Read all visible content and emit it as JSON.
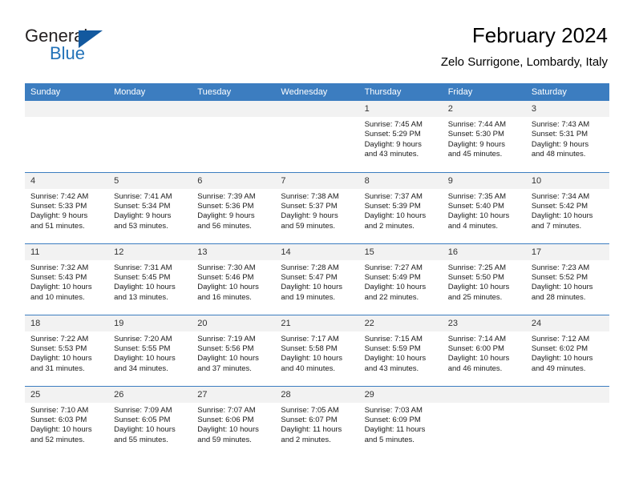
{
  "brand": {
    "name_part1": "General",
    "name_part2": "Blue",
    "accent_color": "#2272b8",
    "triangle_color": "#13599f"
  },
  "header": {
    "title": "February 2024",
    "subtitle": "Zelo Surrigone, Lombardy, Italy"
  },
  "theme": {
    "header_bg": "#3c7dc0",
    "daynum_bg": "#f2f2f2",
    "cell_bg": "#ffffff"
  },
  "weekday_headers": [
    "Sunday",
    "Monday",
    "Tuesday",
    "Wednesday",
    "Thursday",
    "Friday",
    "Saturday"
  ],
  "weeks": [
    [
      {
        "day": "",
        "sunrise": "",
        "sunset": "",
        "daylight1": "",
        "daylight2": ""
      },
      {
        "day": "",
        "sunrise": "",
        "sunset": "",
        "daylight1": "",
        "daylight2": ""
      },
      {
        "day": "",
        "sunrise": "",
        "sunset": "",
        "daylight1": "",
        "daylight2": ""
      },
      {
        "day": "",
        "sunrise": "",
        "sunset": "",
        "daylight1": "",
        "daylight2": ""
      },
      {
        "day": "1",
        "sunrise": "Sunrise: 7:45 AM",
        "sunset": "Sunset: 5:29 PM",
        "daylight1": "Daylight: 9 hours",
        "daylight2": "and 43 minutes."
      },
      {
        "day": "2",
        "sunrise": "Sunrise: 7:44 AM",
        "sunset": "Sunset: 5:30 PM",
        "daylight1": "Daylight: 9 hours",
        "daylight2": "and 45 minutes."
      },
      {
        "day": "3",
        "sunrise": "Sunrise: 7:43 AM",
        "sunset": "Sunset: 5:31 PM",
        "daylight1": "Daylight: 9 hours",
        "daylight2": "and 48 minutes."
      }
    ],
    [
      {
        "day": "4",
        "sunrise": "Sunrise: 7:42 AM",
        "sunset": "Sunset: 5:33 PM",
        "daylight1": "Daylight: 9 hours",
        "daylight2": "and 51 minutes."
      },
      {
        "day": "5",
        "sunrise": "Sunrise: 7:41 AM",
        "sunset": "Sunset: 5:34 PM",
        "daylight1": "Daylight: 9 hours",
        "daylight2": "and 53 minutes."
      },
      {
        "day": "6",
        "sunrise": "Sunrise: 7:39 AM",
        "sunset": "Sunset: 5:36 PM",
        "daylight1": "Daylight: 9 hours",
        "daylight2": "and 56 minutes."
      },
      {
        "day": "7",
        "sunrise": "Sunrise: 7:38 AM",
        "sunset": "Sunset: 5:37 PM",
        "daylight1": "Daylight: 9 hours",
        "daylight2": "and 59 minutes."
      },
      {
        "day": "8",
        "sunrise": "Sunrise: 7:37 AM",
        "sunset": "Sunset: 5:39 PM",
        "daylight1": "Daylight: 10 hours",
        "daylight2": "and 2 minutes."
      },
      {
        "day": "9",
        "sunrise": "Sunrise: 7:35 AM",
        "sunset": "Sunset: 5:40 PM",
        "daylight1": "Daylight: 10 hours",
        "daylight2": "and 4 minutes."
      },
      {
        "day": "10",
        "sunrise": "Sunrise: 7:34 AM",
        "sunset": "Sunset: 5:42 PM",
        "daylight1": "Daylight: 10 hours",
        "daylight2": "and 7 minutes."
      }
    ],
    [
      {
        "day": "11",
        "sunrise": "Sunrise: 7:32 AM",
        "sunset": "Sunset: 5:43 PM",
        "daylight1": "Daylight: 10 hours",
        "daylight2": "and 10 minutes."
      },
      {
        "day": "12",
        "sunrise": "Sunrise: 7:31 AM",
        "sunset": "Sunset: 5:45 PM",
        "daylight1": "Daylight: 10 hours",
        "daylight2": "and 13 minutes."
      },
      {
        "day": "13",
        "sunrise": "Sunrise: 7:30 AM",
        "sunset": "Sunset: 5:46 PM",
        "daylight1": "Daylight: 10 hours",
        "daylight2": "and 16 minutes."
      },
      {
        "day": "14",
        "sunrise": "Sunrise: 7:28 AM",
        "sunset": "Sunset: 5:47 PM",
        "daylight1": "Daylight: 10 hours",
        "daylight2": "and 19 minutes."
      },
      {
        "day": "15",
        "sunrise": "Sunrise: 7:27 AM",
        "sunset": "Sunset: 5:49 PM",
        "daylight1": "Daylight: 10 hours",
        "daylight2": "and 22 minutes."
      },
      {
        "day": "16",
        "sunrise": "Sunrise: 7:25 AM",
        "sunset": "Sunset: 5:50 PM",
        "daylight1": "Daylight: 10 hours",
        "daylight2": "and 25 minutes."
      },
      {
        "day": "17",
        "sunrise": "Sunrise: 7:23 AM",
        "sunset": "Sunset: 5:52 PM",
        "daylight1": "Daylight: 10 hours",
        "daylight2": "and 28 minutes."
      }
    ],
    [
      {
        "day": "18",
        "sunrise": "Sunrise: 7:22 AM",
        "sunset": "Sunset: 5:53 PM",
        "daylight1": "Daylight: 10 hours",
        "daylight2": "and 31 minutes."
      },
      {
        "day": "19",
        "sunrise": "Sunrise: 7:20 AM",
        "sunset": "Sunset: 5:55 PM",
        "daylight1": "Daylight: 10 hours",
        "daylight2": "and 34 minutes."
      },
      {
        "day": "20",
        "sunrise": "Sunrise: 7:19 AM",
        "sunset": "Sunset: 5:56 PM",
        "daylight1": "Daylight: 10 hours",
        "daylight2": "and 37 minutes."
      },
      {
        "day": "21",
        "sunrise": "Sunrise: 7:17 AM",
        "sunset": "Sunset: 5:58 PM",
        "daylight1": "Daylight: 10 hours",
        "daylight2": "and 40 minutes."
      },
      {
        "day": "22",
        "sunrise": "Sunrise: 7:15 AM",
        "sunset": "Sunset: 5:59 PM",
        "daylight1": "Daylight: 10 hours",
        "daylight2": "and 43 minutes."
      },
      {
        "day": "23",
        "sunrise": "Sunrise: 7:14 AM",
        "sunset": "Sunset: 6:00 PM",
        "daylight1": "Daylight: 10 hours",
        "daylight2": "and 46 minutes."
      },
      {
        "day": "24",
        "sunrise": "Sunrise: 7:12 AM",
        "sunset": "Sunset: 6:02 PM",
        "daylight1": "Daylight: 10 hours",
        "daylight2": "and 49 minutes."
      }
    ],
    [
      {
        "day": "25",
        "sunrise": "Sunrise: 7:10 AM",
        "sunset": "Sunset: 6:03 PM",
        "daylight1": "Daylight: 10 hours",
        "daylight2": "and 52 minutes."
      },
      {
        "day": "26",
        "sunrise": "Sunrise: 7:09 AM",
        "sunset": "Sunset: 6:05 PM",
        "daylight1": "Daylight: 10 hours",
        "daylight2": "and 55 minutes."
      },
      {
        "day": "27",
        "sunrise": "Sunrise: 7:07 AM",
        "sunset": "Sunset: 6:06 PM",
        "daylight1": "Daylight: 10 hours",
        "daylight2": "and 59 minutes."
      },
      {
        "day": "28",
        "sunrise": "Sunrise: 7:05 AM",
        "sunset": "Sunset: 6:07 PM",
        "daylight1": "Daylight: 11 hours",
        "daylight2": "and 2 minutes."
      },
      {
        "day": "29",
        "sunrise": "Sunrise: 7:03 AM",
        "sunset": "Sunset: 6:09 PM",
        "daylight1": "Daylight: 11 hours",
        "daylight2": "and 5 minutes."
      },
      {
        "day": "",
        "sunrise": "",
        "sunset": "",
        "daylight1": "",
        "daylight2": ""
      },
      {
        "day": "",
        "sunrise": "",
        "sunset": "",
        "daylight1": "",
        "daylight2": ""
      }
    ]
  ]
}
